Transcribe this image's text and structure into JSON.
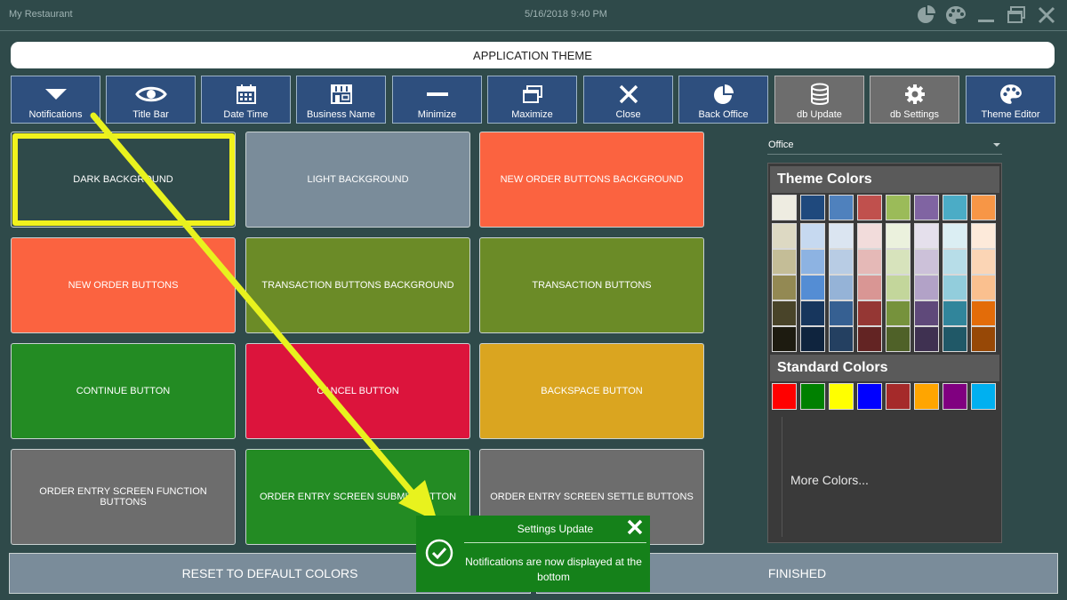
{
  "window": {
    "app_name": "My Restaurant",
    "datetime": "5/16/2018 9:40 PM"
  },
  "header": {
    "title": "APPLICATION THEME"
  },
  "toolbar": {
    "buttons": [
      {
        "label": "Notifications",
        "icon": "triangle-down-icon"
      },
      {
        "label": "Title Bar",
        "icon": "eye-icon"
      },
      {
        "label": "Date Time",
        "icon": "calendar-icon"
      },
      {
        "label": "Business Name",
        "icon": "storefront-icon"
      },
      {
        "label": "Minimize",
        "icon": "minus-icon"
      },
      {
        "label": "Maximize",
        "icon": "window-restore-icon"
      },
      {
        "label": "Close",
        "icon": "x-icon"
      },
      {
        "label": "Back Office",
        "icon": "pie-chart-icon"
      },
      {
        "label": "db Update",
        "icon": "database-icon"
      },
      {
        "label": "db Settings",
        "icon": "gear-icon"
      },
      {
        "label": "Theme Editor",
        "icon": "palette-icon"
      }
    ]
  },
  "tiles": [
    {
      "label": "DARK BACKGROUND",
      "color": "#2f4a4a"
    },
    {
      "label": "LIGHT BACKGROUND",
      "color": "#7a8c9a"
    },
    {
      "label": "NEW ORDER BUTTONS BACKGROUND",
      "color": "#fb6340"
    },
    {
      "label": "NEW ORDER BUTTONS",
      "color": "#fb6340"
    },
    {
      "label": "TRANSACTION BUTTONS BACKGROUND",
      "color": "#6b8b27"
    },
    {
      "label": "TRANSACTION BUTTONS",
      "color": "#6b8b27"
    },
    {
      "label": "CONTINUE BUTTON",
      "color": "#238b23"
    },
    {
      "label": "CANCEL BUTTON",
      "color": "#dc143c"
    },
    {
      "label": "BACKSPACE BUTTON",
      "color": "#daa520"
    },
    {
      "label": "ORDER ENTRY SCREEN FUNCTION BUTTONS",
      "color": "#6d6d6d"
    },
    {
      "label": "ORDER ENTRY SCREEN SUBMIT BUTTON",
      "color": "#238b23"
    },
    {
      "label": "ORDER ENTRY SCREEN SETTLE BUTTONS",
      "color": "#6d6d6d"
    }
  ],
  "palette": {
    "selected_theme": "Office",
    "theme_colors_title": "Theme Colors",
    "theme_top": [
      "#eeece1",
      "#1f497d",
      "#4f81bd",
      "#c0504d",
      "#9bbb59",
      "#8064a2",
      "#4bacc6",
      "#f79646"
    ],
    "theme_shades": [
      [
        "#ddd9c3",
        "#c6d9f0",
        "#dbe5f1",
        "#f2dcdb",
        "#ebf1dd",
        "#e5e0ec",
        "#dbeef3",
        "#fdeada"
      ],
      [
        "#c4bd97",
        "#8db3e2",
        "#b8cce4",
        "#e5b9b7",
        "#d7e3bc",
        "#ccc1d9",
        "#b7dde8",
        "#fbd5b5"
      ],
      [
        "#938953",
        "#548dd4",
        "#95b3d7",
        "#d99694",
        "#c3d69b",
        "#b2a2c7",
        "#92cddc",
        "#fac08f"
      ],
      [
        "#494429",
        "#17365d",
        "#366092",
        "#953734",
        "#76923c",
        "#5f497a",
        "#31859b",
        "#e36c09"
      ],
      [
        "#1d1b10",
        "#0f243e",
        "#244061",
        "#632423",
        "#4f6128",
        "#3f3151",
        "#205867",
        "#974806"
      ]
    ],
    "standard_colors_title": "Standard Colors",
    "standard": [
      "#ff0000",
      "#008000",
      "#ffff00",
      "#0000ff",
      "#a52a2a",
      "#ffa500",
      "#800080",
      "#00b0f0"
    ],
    "more_colors": "More Colors..."
  },
  "bottom": {
    "reset_label": "RESET TO DEFAULT COLORS",
    "finished_label": "FINISHED"
  },
  "toast": {
    "title": "Settings Update",
    "message": "Notifications are now displayed at the bottom"
  }
}
